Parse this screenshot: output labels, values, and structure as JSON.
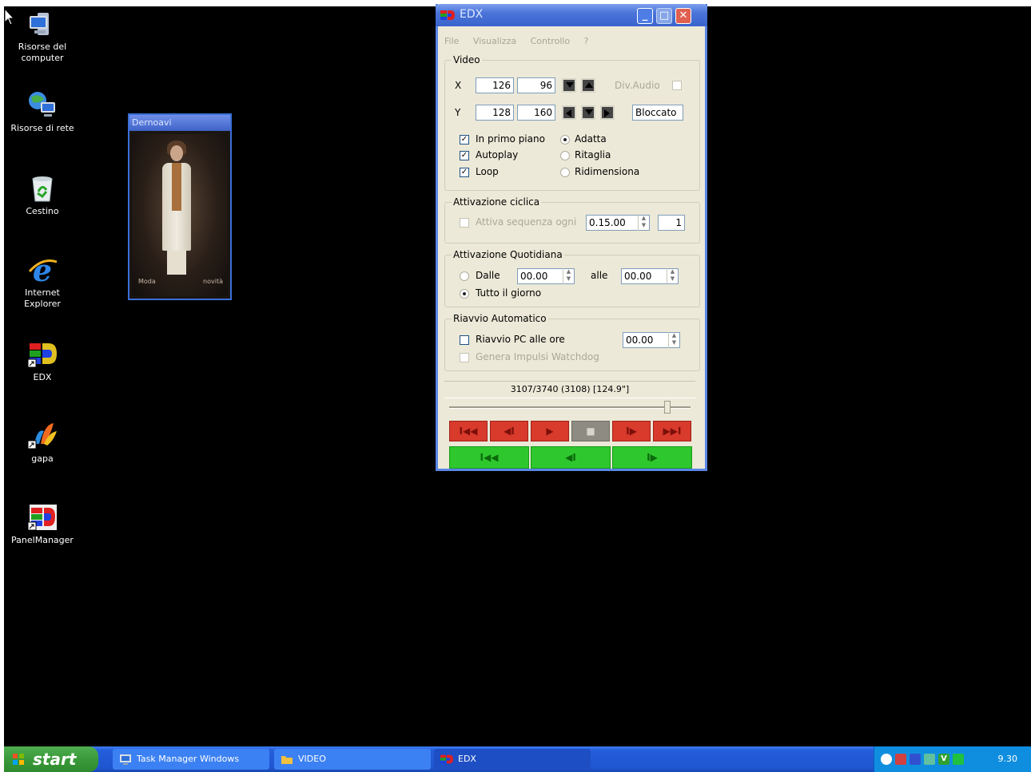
{
  "desktop_icons": [
    {
      "name": "my-computer",
      "label": "Risorse del computer"
    },
    {
      "name": "network-places",
      "label": "Risorse di rete"
    },
    {
      "name": "recycle-bin",
      "label": "Cestino"
    },
    {
      "name": "internet-explorer",
      "label": "Internet Explorer"
    },
    {
      "name": "edx",
      "label": "EDX"
    },
    {
      "name": "gapa",
      "label": "gapa"
    },
    {
      "name": "panel-manager",
      "label": "PanelManager"
    }
  ],
  "preview": {
    "title": "Dernoavi",
    "text_left": "Moda",
    "text_right": "novità"
  },
  "window": {
    "title": "EDX",
    "menu": [
      "File",
      "Visualizza",
      "Controllo",
      "?"
    ],
    "video": {
      "label": "Video",
      "x_label": "X",
      "x_val1": "126",
      "x_val2": "96",
      "y_label": "Y",
      "y_val1": "128",
      "y_val2": "160",
      "div_audio_label": "Div.Audio",
      "lock_label": "Bloccato",
      "in_primo_piano": "In primo piano",
      "autoplay": "Autoplay",
      "loop": "Loop",
      "adatta": "Adatta",
      "ritaglia": "Ritaglia",
      "ridimensiona": "Ridimensiona"
    },
    "cyclic": {
      "label": "Attivazione ciclica",
      "activate_label": "Attiva sequenza ogni",
      "interval": "0.15.00",
      "count": "1"
    },
    "daily": {
      "label": "Attivazione Quotidiana",
      "dalle_label": "Dalle",
      "from_time": "00.00",
      "alle_label": "alle",
      "to_time": "00.00",
      "all_day_label": "Tutto il giorno"
    },
    "restart": {
      "label": "Riavvio Automatico",
      "pc_label": "Riavvio PC alle ore",
      "pc_time": "00.00",
      "watchdog_label": "Genera Impulsi Watchdog"
    },
    "status": "3107/3740 (3108) [124.9\"]",
    "progress": 0.9,
    "playback": [
      "I◀◀",
      "◀I",
      "▶",
      "■",
      "I▶",
      "▶▶I"
    ],
    "nav": [
      "I◀◀",
      "◀I",
      "I▶"
    ]
  },
  "taskbar": {
    "start_label": "start",
    "tasks": [
      {
        "label": "Task Manager Windows"
      },
      {
        "label": "VIDEO"
      },
      {
        "label": "EDX"
      }
    ],
    "clock": "9.30",
    "tray_badge": "V"
  }
}
